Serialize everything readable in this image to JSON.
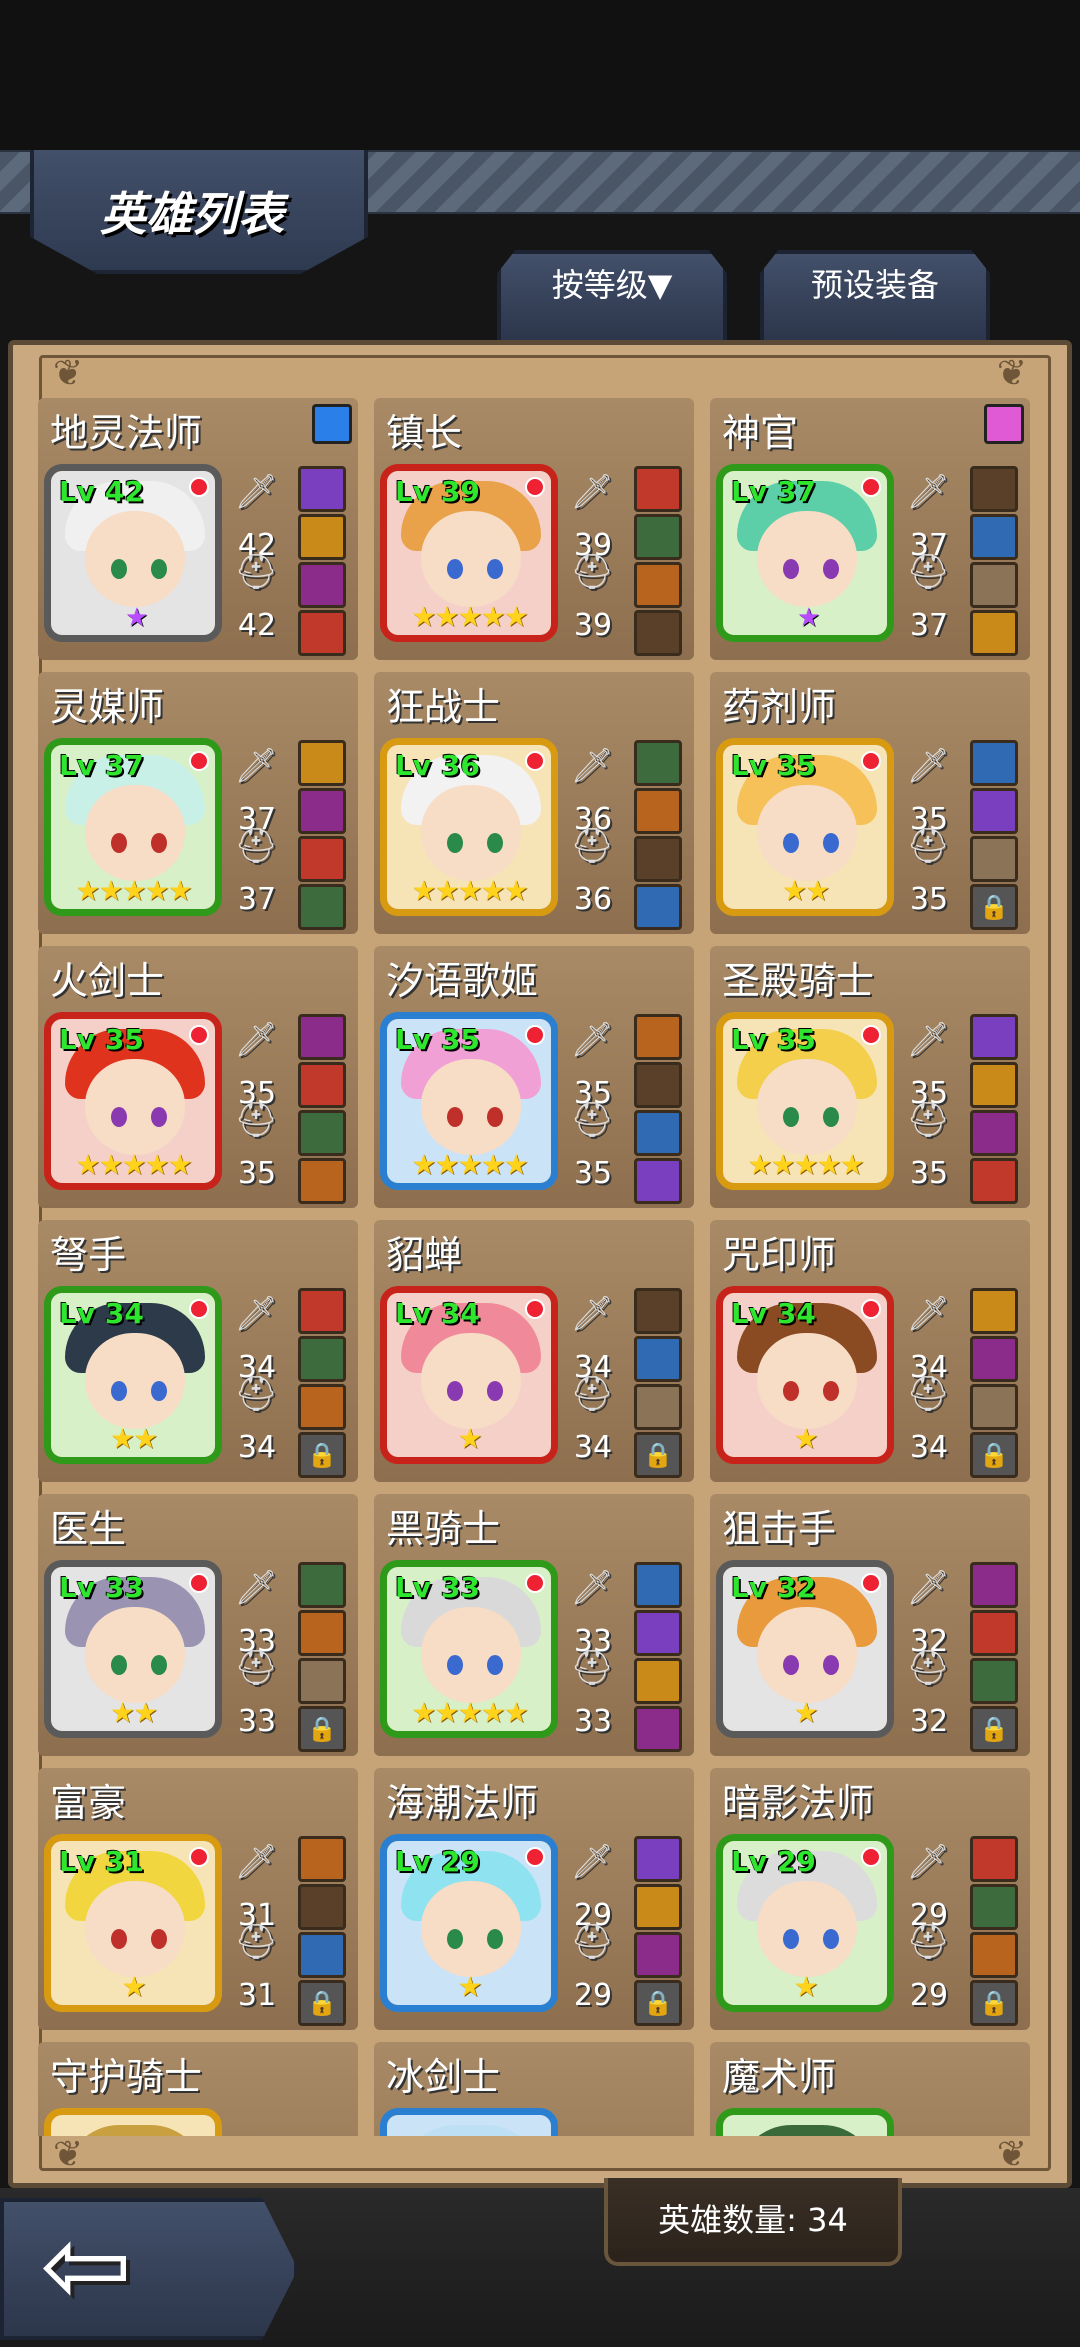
{
  "header": {
    "title": "英雄列表"
  },
  "tabs": {
    "sort_label": "按等级▼",
    "preset_label": "预设装备"
  },
  "footer": {
    "hero_count_label": "英雄数量: 34",
    "back_icon": "back-arrow-icon"
  },
  "colors": {
    "frame_green": "#2f9a1a",
    "frame_red": "#c8231b",
    "frame_gold": "#d89a10",
    "frame_blue": "#2b7fd0",
    "frame_gray": "#5a5a5a",
    "level_text": "#2ee62e"
  },
  "heroes": [
    {
      "name": "地灵法师",
      "level": "Lv 42",
      "atk": "42",
      "def": "42",
      "frame": "gray",
      "stars": 0,
      "purple_star": true,
      "gem": "blue"
    },
    {
      "name": "镇长",
      "level": "Lv 39",
      "atk": "39",
      "def": "39",
      "frame": "red",
      "stars": 5
    },
    {
      "name": "神官",
      "level": "Lv 37",
      "atk": "37",
      "def": "37",
      "frame": "green",
      "stars": 0,
      "purple_star": true,
      "gem": "pink",
      "empty_slot": true
    },
    {
      "name": "灵媒师",
      "level": "Lv 37",
      "atk": "37",
      "def": "37",
      "frame": "green",
      "stars": 5
    },
    {
      "name": "狂战士",
      "level": "Lv 36",
      "atk": "36",
      "def": "36",
      "frame": "gold",
      "stars": 5
    },
    {
      "name": "药剂师",
      "level": "Lv 35",
      "atk": "35",
      "def": "35",
      "frame": "gold",
      "stars": 2,
      "empty_slot": true,
      "locked": true
    },
    {
      "name": "火剑士",
      "level": "Lv 35",
      "atk": "35",
      "def": "35",
      "frame": "red",
      "stars": 5
    },
    {
      "name": "汐语歌姬",
      "level": "Lv 35",
      "atk": "35",
      "def": "35",
      "frame": "blue",
      "stars": 5
    },
    {
      "name": "圣殿骑士",
      "level": "Lv 35",
      "atk": "35",
      "def": "35",
      "frame": "gold",
      "stars": 5
    },
    {
      "name": "弩手",
      "level": "Lv 34",
      "atk": "34",
      "def": "34",
      "frame": "green",
      "stars": 2,
      "locked": true
    },
    {
      "name": "貂蝉",
      "level": "Lv 34",
      "atk": "34",
      "def": "34",
      "frame": "red",
      "stars": 1,
      "empty_slot": true,
      "locked": true
    },
    {
      "name": "咒印师",
      "level": "Lv 34",
      "atk": "34",
      "def": "34",
      "frame": "red",
      "stars": 1,
      "empty_slot": true,
      "locked": true
    },
    {
      "name": "医生",
      "level": "Lv 33",
      "atk": "33",
      "def": "33",
      "frame": "gray",
      "stars": 2,
      "empty_slot": true,
      "locked": true
    },
    {
      "name": "黑骑士",
      "level": "Lv 33",
      "atk": "33",
      "def": "33",
      "frame": "green",
      "stars": 5
    },
    {
      "name": "狙击手",
      "level": "Lv 32",
      "atk": "32",
      "def": "32",
      "frame": "gray",
      "stars": 1,
      "locked": true
    },
    {
      "name": "富豪",
      "level": "Lv 31",
      "atk": "31",
      "def": "31",
      "frame": "gold",
      "stars": 1,
      "locked": true
    },
    {
      "name": "海潮法师",
      "level": "Lv 29",
      "atk": "29",
      "def": "29",
      "frame": "blue",
      "stars": 1,
      "locked": true
    },
    {
      "name": "暗影法师",
      "level": "Lv 29",
      "atk": "29",
      "def": "29",
      "frame": "green",
      "stars": 1,
      "locked": true
    },
    {
      "name": "守护骑士",
      "level": "",
      "atk": "",
      "def": "",
      "frame": "gold",
      "stars": 0
    },
    {
      "name": "冰剑士",
      "level": "",
      "atk": "",
      "def": "",
      "frame": "blue",
      "stars": 0
    },
    {
      "name": "魔术师",
      "level": "",
      "atk": "",
      "def": "",
      "frame": "green",
      "stars": 0
    }
  ]
}
